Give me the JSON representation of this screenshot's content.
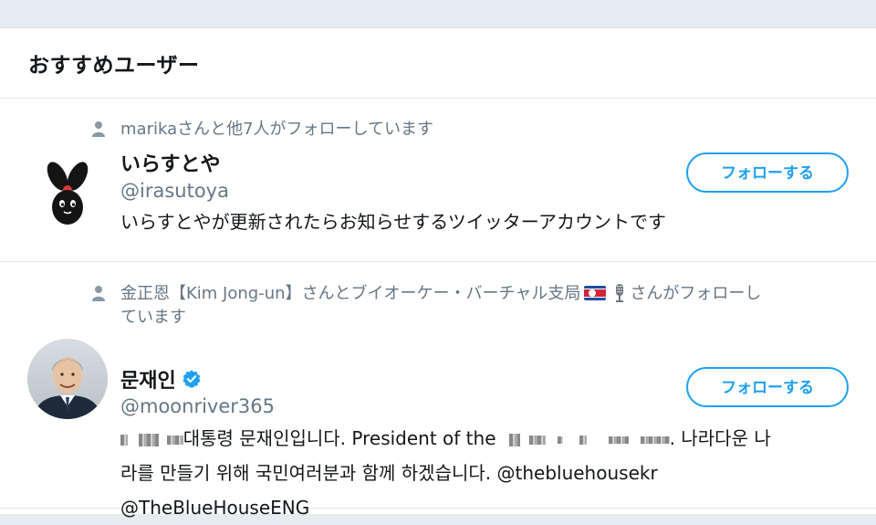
{
  "panel": {
    "title": "おすすめユーザー"
  },
  "users": [
    {
      "social_context": "marikaさんと他7人がフォローしています",
      "display_name": "いらすとや",
      "handle": "@irasutoya",
      "bio": "いらすとやが更新されたらお知らせするツイッターアカウントです",
      "verified": false,
      "follow_label": "フォローする"
    },
    {
      "social_context_a": "金正恩【Kim Jong-un】さんとブイオーケー・バーチャル支局",
      "social_context_b": "さんがフォローし",
      "social_context_c": "ています",
      "display_name": "문재인",
      "handle": "@moonriver365",
      "bio_a": "대통령 문재인입니다. President of the",
      "bio_b": ". 나라다운 나",
      "bio_c": "라를 만들기 위해 국민여러분과 함께 하겠습니다. @thebluehousekr",
      "bio_d": "@TheBlueHouseENG",
      "verified": true,
      "follow_label": "フォローする"
    }
  ],
  "colors": {
    "accent": "#1da1f2",
    "muted": "#657786",
    "text": "#14171a",
    "border": "#e1e8ed"
  },
  "icons": [
    "person-icon",
    "verified-badge-icon",
    "flag-icon",
    "microphone-icon"
  ]
}
